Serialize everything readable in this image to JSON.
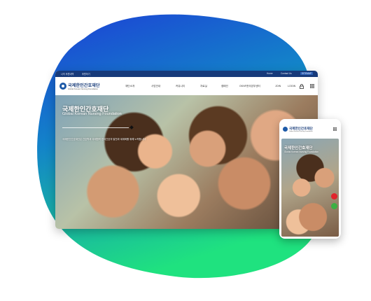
{
  "desktop": {
    "topbar": {
      "left_links": [
        "나의 후원내역",
        "후원하기"
      ],
      "right_links": [
        "Home",
        "Contact Us",
        "SITEMAP"
      ]
    },
    "logo": {
      "ko": "국제한인간호재단",
      "en": "Global Korean Nursing Foundation"
    },
    "menu": [
      "재단소개",
      "사업안내",
      "커뮤니티",
      "자료실",
      "캠페인",
      "GKNF한국본부센터",
      "JOIN",
      "LOGIN"
    ],
    "hero": {
      "title": "국제한인간호재단",
      "subtitle": "Global Korean Nursing Foundation",
      "description": "국제한인간호재단은 간호학과 국제협력 한국간호의 발전과 세계화를 위해 노력합니다."
    }
  },
  "mobile": {
    "logo": {
      "ko": "국제한인간호재단",
      "en": "Global Korean Nursing Foundation"
    },
    "hero": {
      "title": "국제한인간호재단",
      "subtitle": "Global Korean Nursing Foundation"
    }
  },
  "colors": {
    "brand_navy": "#173a7a",
    "blob_blue": "#1f4fd8",
    "blob_green": "#19d98a",
    "fab_red": "#e0242b",
    "fab_green": "#3cb043"
  }
}
